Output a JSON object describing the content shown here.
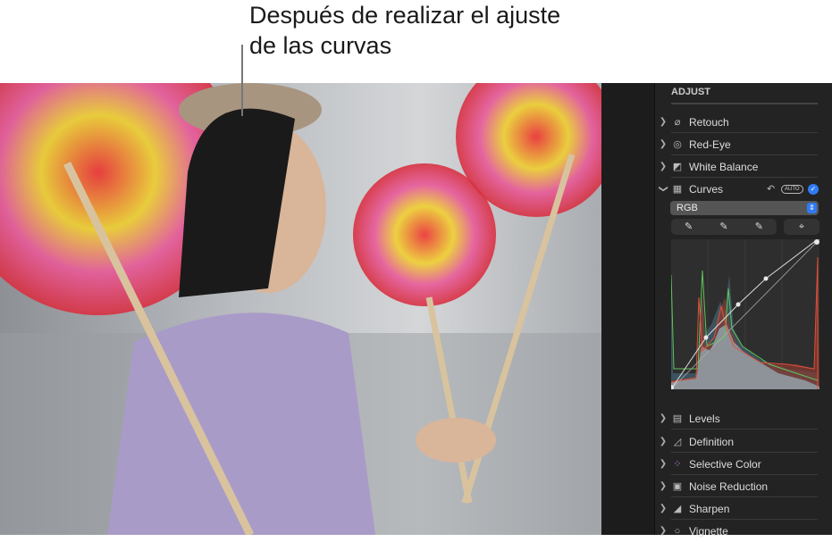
{
  "caption": {
    "line1": "Después de realizar el ajuste",
    "line2": "de las curvas"
  },
  "panel": {
    "title": "ADJUST",
    "items_top": [
      {
        "label": "Retouch",
        "icon": "bandage-icon"
      },
      {
        "label": "Red-Eye",
        "icon": "eye-icon"
      },
      {
        "label": "White Balance",
        "icon": "white-balance-icon"
      }
    ],
    "curves": {
      "label": "Curves",
      "icon": "curves-icon",
      "auto": "AUTO",
      "channel": "RGB",
      "enabled": true
    },
    "items_bottom": [
      {
        "label": "Levels",
        "icon": "levels-icon"
      },
      {
        "label": "Definition",
        "icon": "definition-icon"
      },
      {
        "label": "Selective Color",
        "icon": "selective-color-icon"
      },
      {
        "label": "Noise Reduction",
        "icon": "noise-reduction-icon"
      },
      {
        "label": "Sharpen",
        "icon": "sharpen-icon"
      },
      {
        "label": "Vignette",
        "icon": "vignette-icon"
      }
    ]
  },
  "colors": {
    "accent": "#2f7bf5",
    "red": "#e0503a",
    "green": "#5fc45a"
  }
}
